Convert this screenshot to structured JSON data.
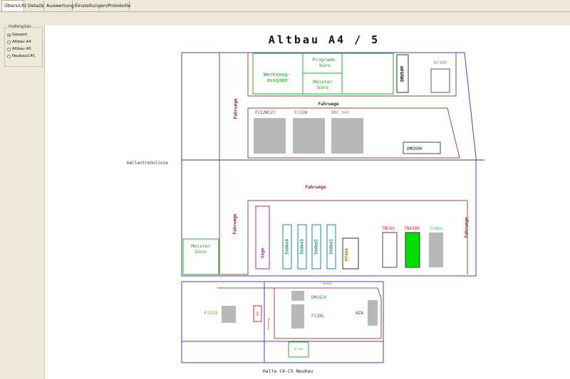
{
  "tabs": [
    {
      "label": "Übersicht",
      "active": true
    },
    {
      "label": "Details"
    },
    {
      "label": "Auswertung"
    },
    {
      "label": "Einstellungen/Protokolle"
    }
  ],
  "hallenplan": {
    "title": "Hallenplan",
    "options": [
      {
        "label": "Gesamt",
        "selected": true
      },
      {
        "label": "Altbau A4"
      },
      {
        "label": "Altbau A5"
      },
      {
        "label": "NeubauC4C"
      }
    ]
  },
  "map": {
    "title": "Altbau A4 / 5",
    "footer": "Halle C4-C5 Neubau",
    "hallentrennlinie": "Hallentrennlinie",
    "fahrwege": "Fahrwege",
    "rooms": {
      "programm": "Programm-\nbüro",
      "meister_top": "Meister\nbüro",
      "werkzeug": "Werkzeug-\nausgabe",
      "meister_left": "Meister\nbüro"
    },
    "machines": {
      "nt300": "NT300",
      "dmu50": "DMU50M",
      "fz12w2": "Fz12W(2)",
      "fz12w": "Fz12W",
      "dmc64v": "DMC 64V",
      "dmu50v": "DMU50V",
      "saege": "Säge",
      "index4": "Index4",
      "index3": "Index3",
      "index2": "Index2",
      "index1": "Index1",
      "mt400": "MT400",
      "tnc65": "TNC65",
      "tna300": "TNA300",
      "index": "Index",
      "fz12s": "Fz12S",
      "dmc63v": "DMC63V",
      "fz18l": "Fz18L",
      "aza": "AZA",
      "small_red": "NSD",
      "small_green": "DC Ana",
      "small_top": "Winter"
    }
  },
  "colors": {
    "blue_line": "#4a3cc8",
    "brown_line": "#9a4a3c",
    "green_line": "#22b022",
    "gray_fill": "#b8b8b8",
    "text_blue": "#3a2acc",
    "text_green": "#1a9a1a",
    "text_gray": "#8a8a8a",
    "text_brown": "#8a2a2a",
    "text_teal": "#1a8a8a",
    "text_red": "#dd2222",
    "text_cyan": "#22bbcc",
    "text_olive": "#8a8a00",
    "text_purple": "#9a2aaa",
    "active_green": "#00dd00"
  }
}
